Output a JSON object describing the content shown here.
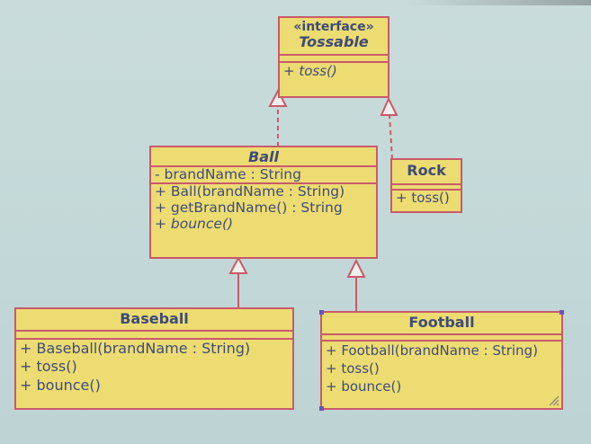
{
  "classes": {
    "tossable": {
      "stereotype": "«interface»",
      "name": "Tossable",
      "operations": [
        "+ toss()"
      ]
    },
    "ball": {
      "name": "Ball",
      "attributes": [
        "- brandName : String"
      ],
      "operations": [
        "+ Ball(brandName : String)",
        "+ getBrandName() : String",
        "+ bounce()"
      ]
    },
    "rock": {
      "name": "Rock",
      "operations": [
        "+ toss()"
      ]
    },
    "baseball": {
      "name": "Baseball",
      "operations": [
        "+ Baseball(brandName : String)",
        "+ toss()",
        "+ bounce()"
      ]
    },
    "football": {
      "name": "Football",
      "operations": [
        "+ Football(brandName : String)",
        "+ toss()",
        "+ bounce()"
      ]
    }
  },
  "colors": {
    "background": "#c6dada",
    "box_fill": "#ecdc72",
    "box_border": "#c95a6a",
    "text": "#3f4c78",
    "selection_handle": "#6a52c4"
  }
}
